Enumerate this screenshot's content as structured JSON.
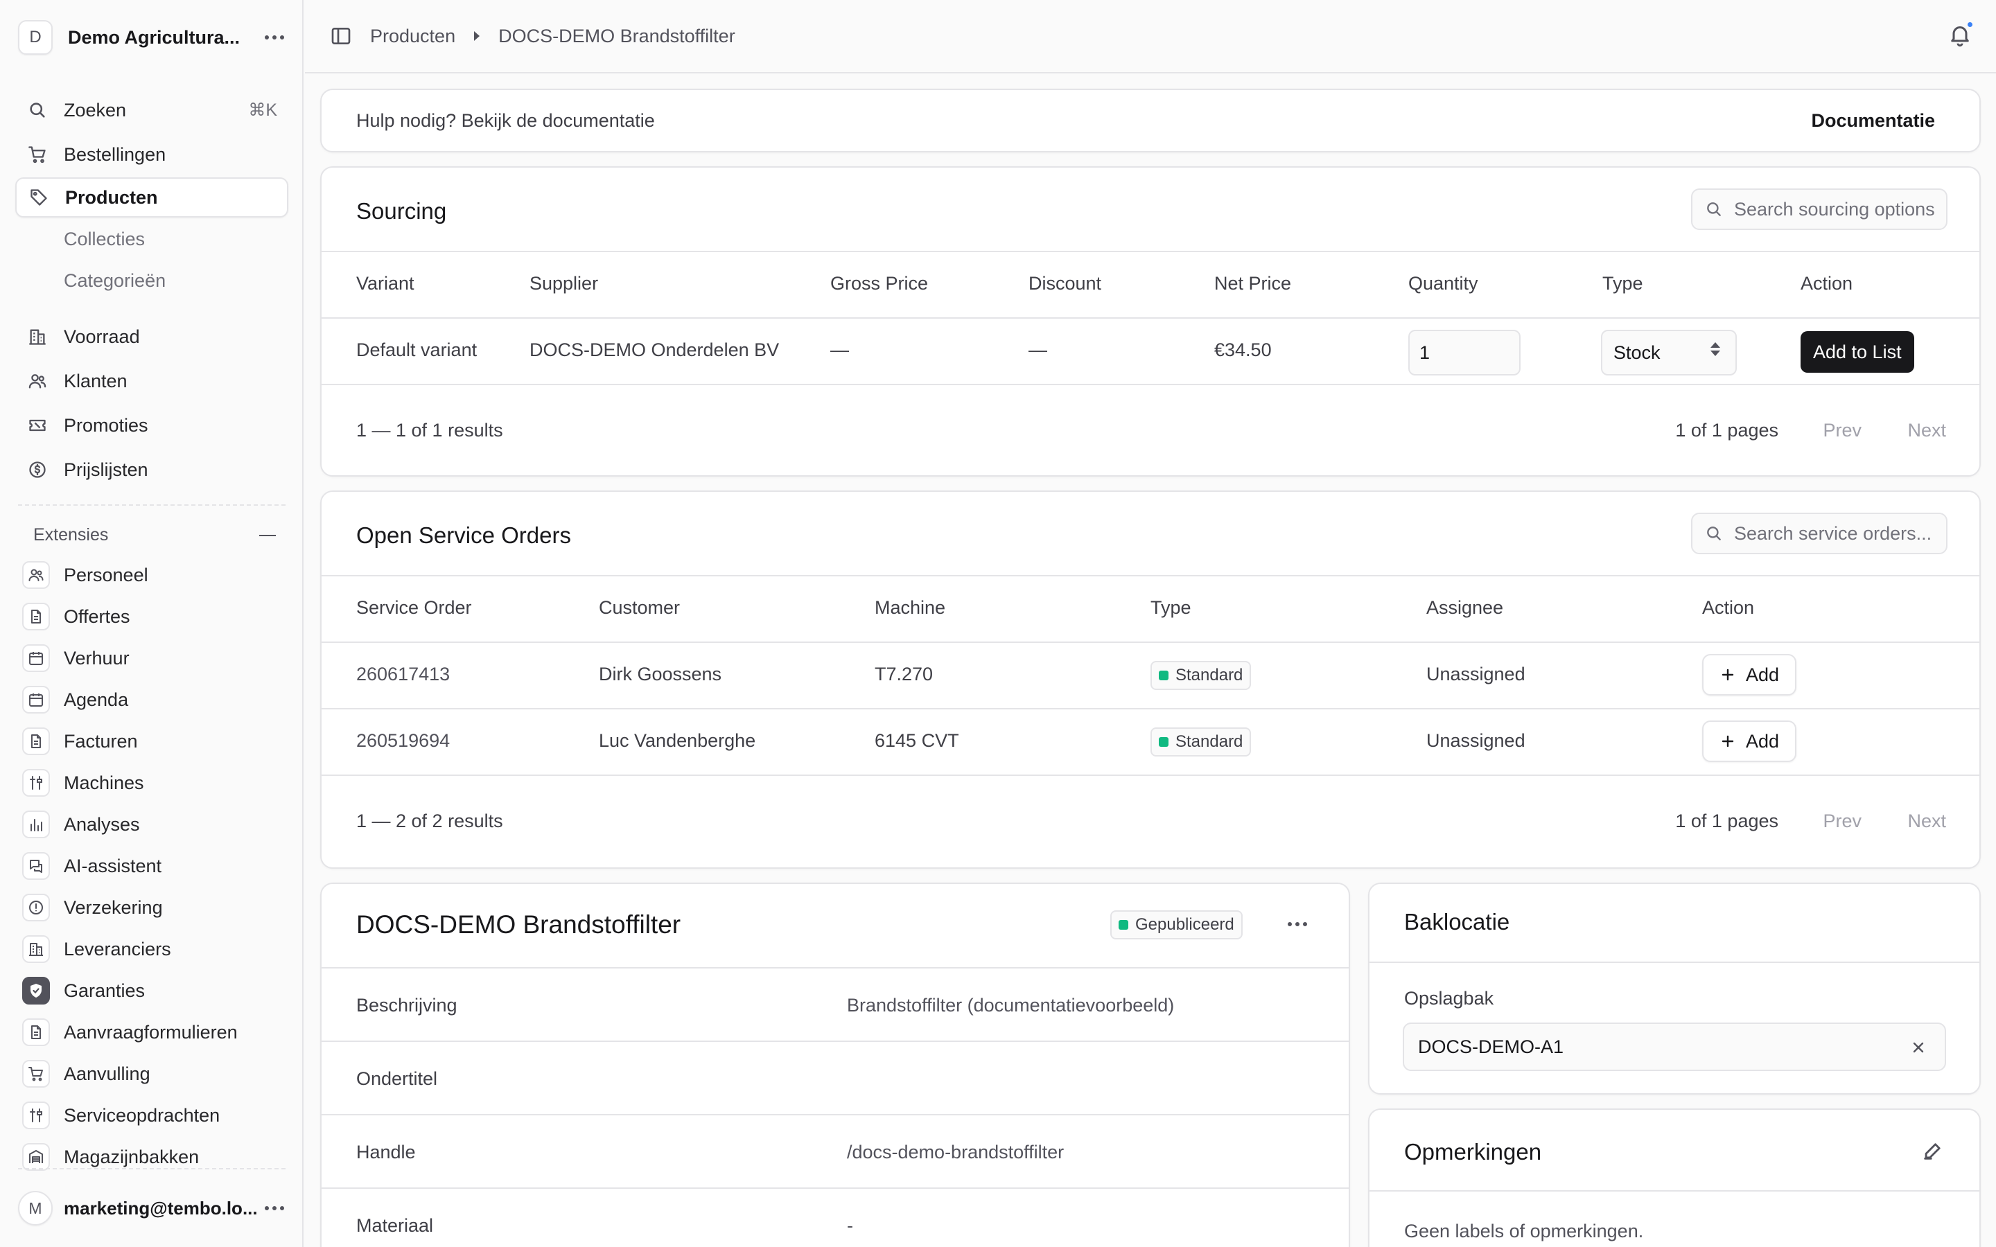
{
  "sidebar": {
    "store_initial": "D",
    "store_name": "Demo Agricultura...",
    "search_label": "Zoeken",
    "search_shortcut": "⌘K",
    "nav": [
      {
        "label": "Bestellingen",
        "icon": "cart-icon"
      },
      {
        "label": "Producten",
        "icon": "tag-icon"
      },
      {
        "label": "Voorraad",
        "icon": "building-icon"
      },
      {
        "label": "Klanten",
        "icon": "users-icon"
      },
      {
        "label": "Promoties",
        "icon": "ticket-icon"
      },
      {
        "label": "Prijslijsten",
        "icon": "dollar-icon"
      }
    ],
    "sub_items": [
      "Collecties",
      "Categorieën"
    ],
    "extensions_title": "Extensies",
    "extensions": [
      {
        "label": "Personeel",
        "icon": "users-icon"
      },
      {
        "label": "Offertes",
        "icon": "document-icon"
      },
      {
        "label": "Verhuur",
        "icon": "calendar-icon"
      },
      {
        "label": "Agenda",
        "icon": "calendar-icon"
      },
      {
        "label": "Facturen",
        "icon": "document-icon"
      },
      {
        "label": "Machines",
        "icon": "tools-icon"
      },
      {
        "label": "Analyses",
        "icon": "chart-icon"
      },
      {
        "label": "AI-assistent",
        "icon": "chat-icon"
      },
      {
        "label": "Verzekering",
        "icon": "alert-icon"
      },
      {
        "label": "Leveranciers",
        "icon": "building-icon"
      },
      {
        "label": "Garanties",
        "icon": "shield-icon"
      },
      {
        "label": "Aanvraagformulieren",
        "icon": "document-icon"
      },
      {
        "label": "Aanvulling",
        "icon": "cart-icon"
      },
      {
        "label": "Serviceopdrachten",
        "icon": "tools-icon"
      },
      {
        "label": "Magazijnbakken",
        "icon": "warehouse-icon"
      }
    ],
    "user_initial": "M",
    "user_email": "marketing@tembo.lo..."
  },
  "breadcrumb": [
    "Producten",
    "DOCS-DEMO Brandstoffilter"
  ],
  "help": {
    "text": "Hulp nodig? Bekijk de documentatie",
    "link": "Documentatie"
  },
  "sourcing": {
    "title": "Sourcing",
    "search_placeholder": "Search sourcing options",
    "columns": [
      "Variant",
      "Supplier",
      "Gross Price",
      "Discount",
      "Net Price",
      "Quantity",
      "Type",
      "Action"
    ],
    "row": {
      "variant": "Default variant",
      "supplier": "DOCS-DEMO Onderdelen BV",
      "gross": "—",
      "discount": "—",
      "net": "€34.50",
      "quantity": "1",
      "type": "Stock",
      "action": "Add to List"
    },
    "count": "1 — 1 of 1 results",
    "pages": "1 of 1 pages",
    "prev": "Prev",
    "next": "Next"
  },
  "service_orders": {
    "title": "Open Service Orders",
    "search_placeholder": "Search service orders...",
    "columns": [
      "Service Order",
      "Customer",
      "Machine",
      "Type",
      "Assignee",
      "Action"
    ],
    "rows": [
      {
        "order": "260617413",
        "customer": "Dirk Goossens",
        "machine": "T7.270",
        "type": "Standard",
        "assignee": "Unassigned",
        "action": "Add"
      },
      {
        "order": "260519694",
        "customer": "Luc Vandenberghe",
        "machine": "6145 CVT",
        "type": "Standard",
        "assignee": "Unassigned",
        "action": "Add"
      }
    ],
    "count": "1 — 2 of 2 results",
    "pages": "1 of 1 pages",
    "prev": "Prev",
    "next": "Next"
  },
  "product": {
    "title": "DOCS-DEMO Brandstoffilter",
    "status": "Gepubliceerd",
    "fields": [
      {
        "label": "Beschrijving",
        "value": "Brandstoffilter (documentatievoorbeeld)"
      },
      {
        "label": "Ondertitel",
        "value": ""
      },
      {
        "label": "Handle",
        "value": "/docs-demo-brandstoffilter"
      },
      {
        "label": "Materiaal",
        "value": "-"
      }
    ]
  },
  "bin": {
    "title": "Baklocatie",
    "label": "Opslagbak",
    "value": "DOCS-DEMO-A1"
  },
  "notes": {
    "title": "Opmerkingen",
    "empty": "Geen labels of opmerkingen."
  },
  "colors": {
    "accent": "#18181b",
    "published": "#10b981",
    "notification": "#3b82f6"
  }
}
